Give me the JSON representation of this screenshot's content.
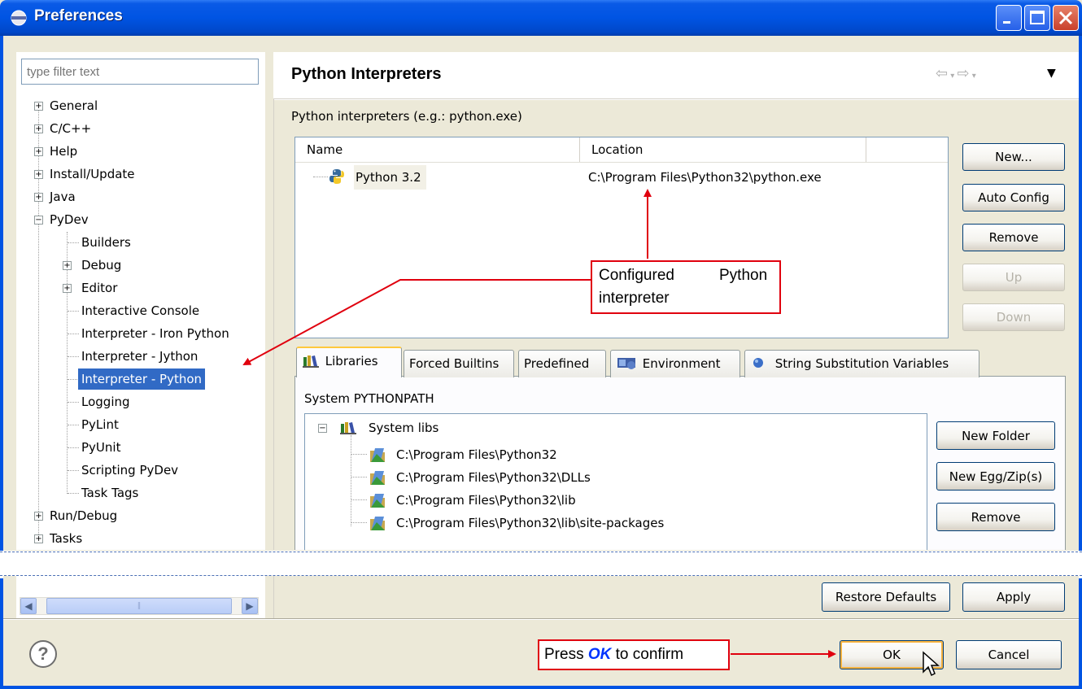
{
  "window": {
    "title": "Preferences"
  },
  "filter": {
    "placeholder": "type filter text"
  },
  "tree": [
    {
      "label": "General"
    },
    {
      "label": "C/C++"
    },
    {
      "label": "Help"
    },
    {
      "label": "Install/Update"
    },
    {
      "label": "Java"
    },
    {
      "label": "PyDev"
    },
    {
      "label": "Builders"
    },
    {
      "label": "Debug"
    },
    {
      "label": "Editor"
    },
    {
      "label": "Interactive Console"
    },
    {
      "label": "Interpreter - Iron Python"
    },
    {
      "label": "Interpreter - Jython"
    },
    {
      "label": "Interpreter - Python"
    },
    {
      "label": "Logging"
    },
    {
      "label": "PyLint"
    },
    {
      "label": "PyUnit"
    },
    {
      "label": "Scripting PyDev"
    },
    {
      "label": "Task Tags"
    },
    {
      "label": "Run/Debug"
    },
    {
      "label": "Tasks"
    }
  ],
  "page": {
    "title": "Python Interpreters",
    "interpreters_label": "Python interpreters (e.g.: python.exe)",
    "columns": [
      "Name",
      "Location"
    ],
    "interpreters": [
      {
        "name": "Python 3.2",
        "location": "C:\\Program Files\\Python32\\python.exe"
      }
    ],
    "buttons": [
      "New...",
      "Auto Config",
      "Remove",
      "Up",
      "Down"
    ],
    "tabs": [
      "Libraries",
      "Forced Builtins",
      "Predefined",
      "Environment",
      "String Substitution Variables"
    ],
    "pythonpath_label": "System PYTHONPATH",
    "libs_root": "System libs",
    "libs": [
      "C:\\Program Files\\Python32",
      "C:\\Program Files\\Python32\\DLLs",
      "C:\\Program Files\\Python32\\lib",
      "C:\\Program Files\\Python32\\lib\\site-packages"
    ],
    "lib_buttons": [
      "New Folder",
      "New Egg/Zip(s)",
      "Remove"
    ],
    "restore_defaults": "Restore Defaults",
    "apply": "Apply"
  },
  "footer": {
    "ok": "OK",
    "cancel": "Cancel",
    "help_glyph": "?"
  },
  "annotations": {
    "interpreter_line1_a": "Configured",
    "interpreter_line1_b": "Python",
    "interpreter_line2": "interpreter",
    "ok_prefix": "Press",
    "ok_emphasis": "OK",
    "ok_suffix": "to confirm"
  },
  "colors": {
    "selection": "#316ac5",
    "titlebar": "#0054e3",
    "annotation": "#e0000e",
    "ok_emphasis": "#0033ff"
  }
}
